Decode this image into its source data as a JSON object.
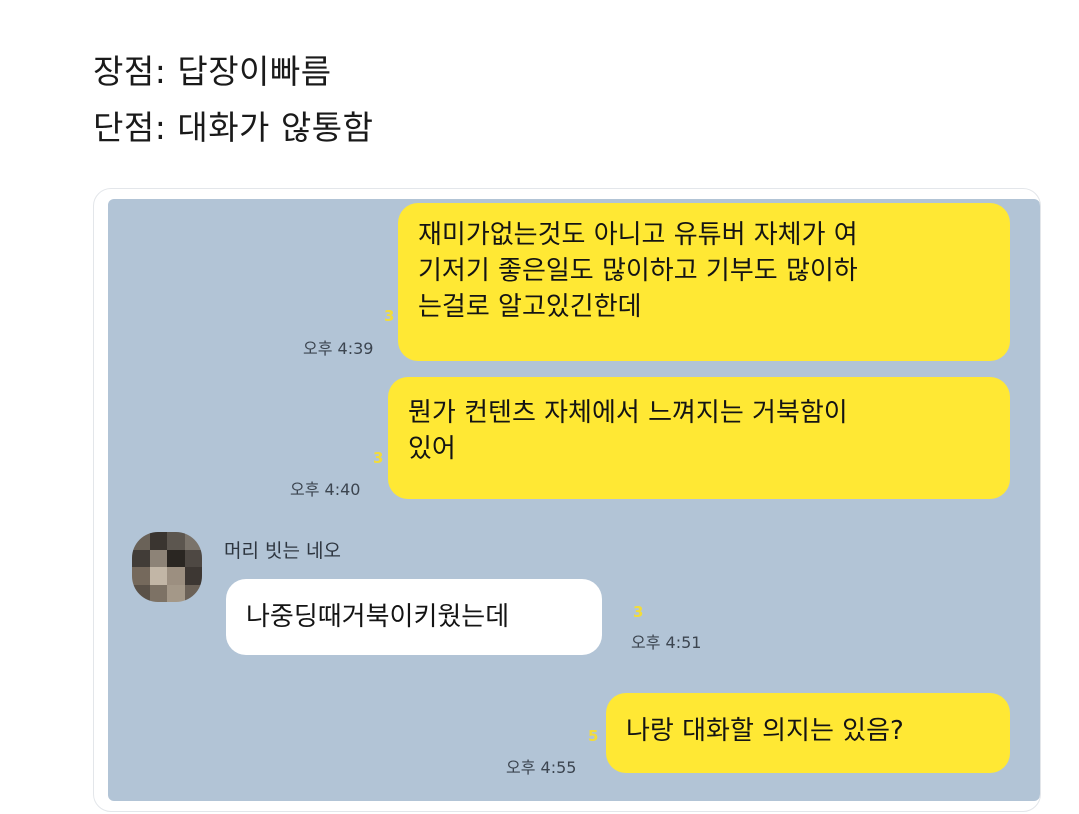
{
  "caption": {
    "line1": "장점: 답장이빠름",
    "line2": "단점: 대화가 않통함"
  },
  "chat": {
    "sender_name": "머리 빗는 네오",
    "messages": [
      {
        "from": "me",
        "text": "재미가없는것도 아니고 유튜버 자체가 여\n기저기 좋은일도 많이하고 기부도 많이하\n는걸로 알고있긴한데",
        "unread": "3",
        "time": "오후 4:39"
      },
      {
        "from": "me",
        "text": "뭔가 컨텐츠 자체에서 느껴지는 거북함이\n있어",
        "unread": "3",
        "time": "오후 4:40"
      },
      {
        "from": "other",
        "text": "나중딩때거북이키웠는데",
        "unread": "3",
        "time": "오후 4:51"
      },
      {
        "from": "me",
        "text": "나랑 대화할 의지는 있음?",
        "unread": "5",
        "time": "오후 4:55"
      }
    ]
  },
  "colors": {
    "chat_background": "#b2c4d6",
    "my_bubble": "#ffe834",
    "other_bubble": "#ffffff",
    "unread_count": "#f2dc3a"
  }
}
